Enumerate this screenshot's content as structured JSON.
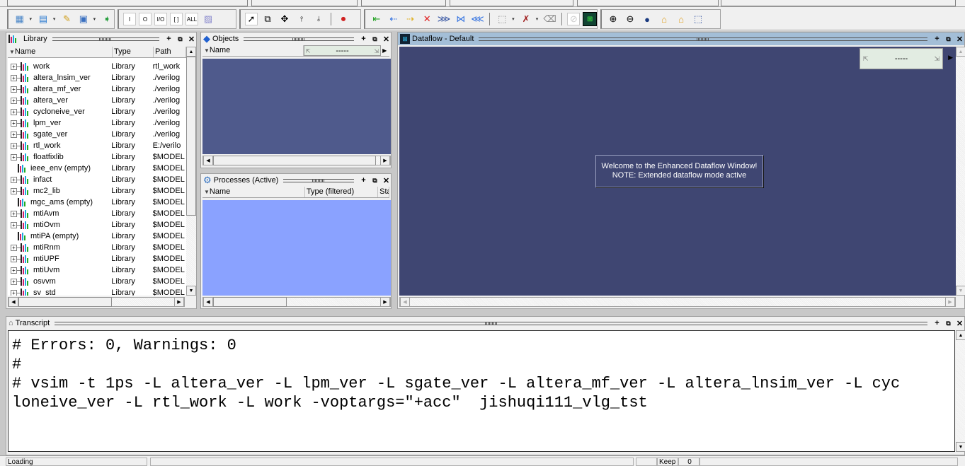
{
  "toolbar": {
    "groups": [
      {
        "name": "dataflow-edit",
        "buttons": [
          "add-wave-icon",
          "remove-icon",
          "edit-icon",
          "save-icon",
          "export-icon"
        ]
      },
      {
        "name": "signal-filter",
        "buttons": [
          {
            "icon": "in-filter-icon",
            "label": "I"
          },
          {
            "icon": "out-filter-icon",
            "label": "O"
          },
          {
            "icon": "inout-filter-icon",
            "label": "I/O"
          },
          {
            "icon": "internal-filter-icon",
            "label": "[ ]"
          },
          {
            "icon": "all-filter-icon",
            "label": "ALL"
          },
          {
            "icon": "filter-brush-icon",
            "label": ""
          }
        ]
      },
      {
        "name": "navigation",
        "buttons": [
          "select-pointer-icon",
          "zoom-select-icon",
          "pan-icon",
          "expand-down-icon",
          "expand-up-icon",
          "traffic-light-icon"
        ]
      },
      {
        "name": "trace",
        "buttons": [
          "trace-input-icon",
          "trace-back-icon",
          "trace-forward-icon",
          "trace-x-icon",
          "trace-in-icon",
          "trace-inout-icon",
          "trace-out-icon",
          "select-region-icon",
          "delete-icon",
          "erase-icon",
          "stop-trace-icon",
          "wave-window-icon"
        ]
      },
      {
        "name": "zoom",
        "buttons": [
          "zoom-in-icon",
          "zoom-out-icon",
          "zoom-full-icon",
          "zoom-back-icon",
          "zoom-forward-icon",
          "zoom-area-icon"
        ]
      }
    ]
  },
  "library": {
    "title": "Library",
    "columns": [
      "Name",
      "Type",
      "Path"
    ],
    "rows": [
      {
        "name": "work",
        "type": "Library",
        "path": "rtl_work",
        "expandable": true
      },
      {
        "name": "altera_lnsim_ver",
        "type": "Library",
        "path": "./verilog",
        "expandable": true
      },
      {
        "name": "altera_mf_ver",
        "type": "Library",
        "path": "./verilog",
        "expandable": true
      },
      {
        "name": "altera_ver",
        "type": "Library",
        "path": "./verilog",
        "expandable": true
      },
      {
        "name": "cycloneive_ver",
        "type": "Library",
        "path": "./verilog",
        "expandable": true
      },
      {
        "name": "lpm_ver",
        "type": "Library",
        "path": "./verilog",
        "expandable": true
      },
      {
        "name": "sgate_ver",
        "type": "Library",
        "path": "./verilog",
        "expandable": true
      },
      {
        "name": "rtl_work",
        "type": "Library",
        "path": "E:/verilo",
        "expandable": true
      },
      {
        "name": "floatfixlib",
        "type": "Library",
        "path": "$MODEL",
        "expandable": true
      },
      {
        "name": "ieee_env  (empty)",
        "type": "Library",
        "path": "$MODEL",
        "expandable": false
      },
      {
        "name": "infact",
        "type": "Library",
        "path": "$MODEL",
        "expandable": true
      },
      {
        "name": "mc2_lib",
        "type": "Library",
        "path": "$MODEL",
        "expandable": true
      },
      {
        "name": "mgc_ams  (empty)",
        "type": "Library",
        "path": "$MODEL",
        "expandable": false
      },
      {
        "name": "mtiAvm",
        "type": "Library",
        "path": "$MODEL",
        "expandable": true
      },
      {
        "name": "mtiOvm",
        "type": "Library",
        "path": "$MODEL",
        "expandable": true
      },
      {
        "name": "mtiPA  (empty)",
        "type": "Library",
        "path": "$MODEL",
        "expandable": false
      },
      {
        "name": "mtiRnm",
        "type": "Library",
        "path": "$MODEL",
        "expandable": true
      },
      {
        "name": "mtiUPF",
        "type": "Library",
        "path": "$MODEL",
        "expandable": true
      },
      {
        "name": "mtiUvm",
        "type": "Library",
        "path": "$MODEL",
        "expandable": true
      },
      {
        "name": "osvvm",
        "type": "Library",
        "path": "$MODEL",
        "expandable": true
      },
      {
        "name": "sv_std",
        "type": "Library",
        "path": "$MODEL",
        "expandable": true
      }
    ]
  },
  "objects": {
    "title": "Objects",
    "columns": [
      "Name"
    ],
    "time_value": "-----"
  },
  "processes": {
    "title": "Processes (Active)",
    "columns": [
      "Name",
      "Type (filtered)",
      "Sta"
    ]
  },
  "dataflow": {
    "title": "Dataflow - Default",
    "time_value": "-----",
    "welcome_line1": "Welcome to the Enhanced Dataflow Window!",
    "welcome_line2": "NOTE: Extended dataflow mode active"
  },
  "transcript": {
    "title": "Transcript",
    "lines": [
      "# Errors: 0, Warnings: 0",
      "#",
      "# vsim -t 1ps -L altera_ver -L lpm_ver -L sgate_ver -L altera_mf_ver -L altera_lnsim_ver -L cyc",
      "loneive_ver -L rtl_work -L work -voptargs=\"+acc\"  jishuqi111_vlg_tst"
    ]
  },
  "statusbar": {
    "status": "Loading",
    "keep_label": "Keep",
    "keep_value": "0"
  },
  "colors": {
    "objects_bg": "#4f5a8c",
    "processes_bg": "#8aa2ff",
    "dataflow_bg": "#3f4672",
    "dataflow_title_bg": "#a3bed7"
  }
}
